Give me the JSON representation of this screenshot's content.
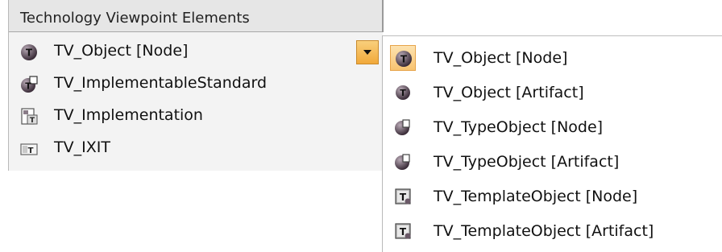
{
  "toolbox": {
    "title": "Technology Viewpoint Elements",
    "items": [
      {
        "label": "TV_Object [Node]",
        "icon": "object-icon"
      },
      {
        "label": "TV_ImplementableStandard",
        "icon": "implementable-standard-icon"
      },
      {
        "label": "TV_Implementation",
        "icon": "implementation-icon"
      },
      {
        "label": "TV_IXIT",
        "icon": "ixit-icon"
      }
    ]
  },
  "dropdown": {
    "icon": "dropdown-arrow-icon",
    "items": [
      {
        "label": "TV_Object [Node]",
        "icon": "object-icon",
        "selected": true
      },
      {
        "label": "TV_Object [Artifact]",
        "icon": "object-icon",
        "selected": false
      },
      {
        "label": "TV_TypeObject [Node]",
        "icon": "type-object-icon",
        "selected": false
      },
      {
        "label": "TV_TypeObject [Artifact]",
        "icon": "type-object-icon",
        "selected": false
      },
      {
        "label": "TV_TemplateObject [Node]",
        "icon": "template-object-icon",
        "selected": false
      },
      {
        "label": "TV_TemplateObject [Artifact]",
        "icon": "template-object-icon",
        "selected": false
      }
    ]
  },
  "colors": {
    "selection_fill": "#f8c370",
    "selection_border": "#e7a44a",
    "icon_dark": "#4a3c48"
  }
}
